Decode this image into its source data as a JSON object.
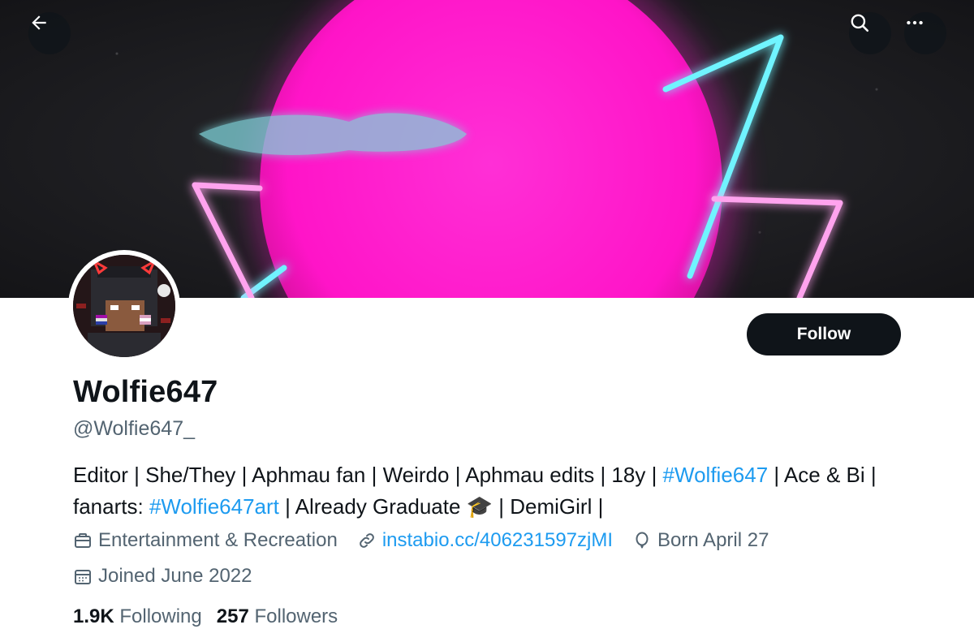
{
  "profile": {
    "display_name": "Wolfie647",
    "handle": "@Wolfie647_",
    "bio": {
      "part1": "Editor | She/They | Aphmau fan | Weirdo | Aphmau edits | 18y | ",
      "tag1": "#Wolfie647",
      "part2": " | Ace & Bi | fanarts: ",
      "tag2": "#Wolfie647art",
      "part3": " | Already Graduate 🎓 | DemiGirl |"
    },
    "category": "Entertainment & Recreation",
    "website": "instabio.cc/406231597zjMI",
    "birthday": "Born April 27",
    "joined": "Joined June 2022",
    "following_count": "1.9K",
    "following_label": "Following",
    "followers_count": "257",
    "followers_label": "Followers"
  },
  "actions": {
    "follow_label": "Follow"
  },
  "icons": {
    "back": "arrow-left-icon",
    "search": "search-icon",
    "more": "more-horizontal-icon",
    "category": "briefcase-icon",
    "website": "link-icon",
    "birthday": "balloon-icon",
    "joined": "calendar-icon"
  },
  "colors": {
    "link": "#1d9bf0",
    "secondary_text": "#536471",
    "primary_text": "#0f1419",
    "follow_button_bg": "#0f1419",
    "banner_sun": "#ff1fd0",
    "banner_neon_cyan": "#5ff2ff",
    "banner_neon_pink": "#ff8fe8"
  }
}
